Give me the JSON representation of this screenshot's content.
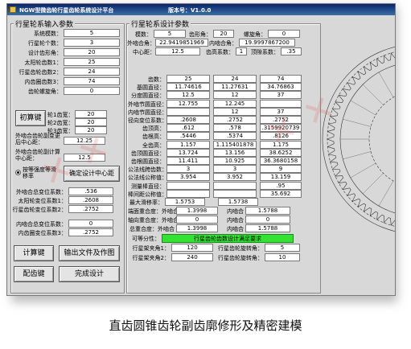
{
  "window": {
    "title": "NGW型微齿轮行星齿轮系统设计平台",
    "version": "版本号：V1.0.0"
  },
  "input_group": {
    "title": "行星轮系输入参数",
    "rows": [
      {
        "label": "系统模数：",
        "value": "5"
      },
      {
        "label": "行星轮个数：",
        "value": "3"
      },
      {
        "label": "设计齿形角：",
        "value": "20"
      },
      {
        "label": "太阳轮齿数1：",
        "value": "25"
      },
      {
        "label": "行星齿轮齿数2：",
        "value": "24"
      },
      {
        "label": "内齿圈齿数3：",
        "value": "74"
      },
      {
        "label": "齿轮螺旋角：",
        "value": "0"
      }
    ],
    "trial_button": "初算键",
    "trial_rows": [
      {
        "label": "轮1齿宽：",
        "value": "20"
      },
      {
        "label": "轮2齿宽：",
        "value": "20"
      },
      {
        "label": "轮3齿宽：",
        "value": "20"
      }
    ],
    "external_center_label": "外啮合齿轮副变更后中心距：",
    "external_center_value": "12.25",
    "external_calc_label": "外啮合齿轮副计算中心距：",
    "external_calc_value": "12.5",
    "radio_option": "按等强度等滑移率",
    "center_button": "确定设计中心距",
    "shift_rows_1": [
      {
        "label": "外啮合总变位系数：",
        "value": ".536"
      },
      {
        "label": "太阳轮变位系数1：",
        "value": ".2608"
      },
      {
        "label": "行星齿轮变位系数2：",
        "value": ".2752"
      }
    ],
    "shift_rows_2": [
      {
        "label": "内啮合总变位系数：",
        "value": "0"
      },
      {
        "label": "内齿圈变位系数3：",
        "value": ".2752"
      }
    ],
    "calc_button": "计算键",
    "export_button": "输出文件及作图",
    "match_button": "配齿键",
    "done_button": "完成设计"
  },
  "design_group": {
    "title": "行星轮系设计参数",
    "module_label": "模数：",
    "module_value": "5",
    "teeth_label": "齿形角：",
    "teeth_value": "20",
    "helix_label": "螺旋角：",
    "helix_value": "0",
    "ext_mesh_label": "外啮合角：",
    "ext_mesh_value": "22.9419851969",
    "int_mesh_label": "内啮合角：",
    "int_mesh_value": "19.9997867200",
    "center_label": "中心距：",
    "center_value": "12.5",
    "tooth_top_label": "齿高系数：",
    "tooth_top_value": "1",
    "clearance_label": "顶隙系数：",
    "clearance_value": ".35",
    "table_rows": [
      {
        "label": "齿数：",
        "v1": "25",
        "v2": "24",
        "v3": "74"
      },
      {
        "label": "基圆直径：",
        "v1": "11.74616",
        "v2": "11.27631",
        "v3": "34.76863"
      },
      {
        "label": "分度圆直径：",
        "v1": "12.5",
        "v2": "12",
        "v3": "37"
      },
      {
        "label": "外啮节圆直径：",
        "v1": "12.755",
        "v2": "12.245",
        "v3": ""
      },
      {
        "label": "内啮节圆直径：",
        "v1": "",
        "v2": "12",
        "v3": "37"
      },
      {
        "label": "径向变位系数：",
        "v1": ".2608",
        "v2": ".2752",
        "v3": ".2752"
      },
      {
        "label": "齿顶高：",
        "v1": ".612",
        "v2": ".578",
        "v3": ".3159920739"
      },
      {
        "label": "齿根高：",
        "v1": ".5446",
        "v2": ".5374",
        "v3": ".8126"
      },
      {
        "label": "全齿高：",
        "v1": "1.157",
        "v2": "1.115401878",
        "v3": "1.175"
      },
      {
        "label": "齿顶圆直径：",
        "v1": "13.724",
        "v2": "13.156",
        "v3": "38.6252"
      },
      {
        "label": "齿根圆直径：",
        "v1": "11.411",
        "v2": "10.925",
        "v3": "36.3680158"
      },
      {
        "label": "公法线跨齿数：",
        "v1": "3",
        "v2": "3",
        "v3": "9"
      },
      {
        "label": "公法线公称值：",
        "v1": "3.954",
        "v2": "3.952",
        "v3": "13.159"
      },
      {
        "label": "测量棒直径：",
        "v1": "",
        "v2": "",
        "v3": ".95"
      },
      {
        "label": "棒间距公称值：",
        "v1": "",
        "v2": "",
        "v3": "35.692"
      }
    ],
    "max_slide_label": "最大滑移率：",
    "max_slide_v1": "1.5753",
    "max_slide_v2": "1.5738",
    "contact_label": "端面重合度：外啮合",
    "contact_v1": "1.3998",
    "contact_inner_label": "内啮合",
    "contact_v2": "1.5788",
    "axial_label": "轴向重合度：外啮合",
    "axial_v1": "0",
    "axial_inner_label": "内啮合",
    "axial_v2": "0",
    "total_label": "总重合度：外啮合",
    "total_v1": "1.3998",
    "total_inner_label": "内啮合",
    "total_v2": "1.5788",
    "check_label": "可等分性：",
    "check_text": "行星齿轮齿数设计满足要求",
    "frame_angle1_label": "行星架夹角1：",
    "frame_angle1_value": "120",
    "frame_rot1_label": "行星齿轮旋转角：",
    "frame_rot1_value": "5",
    "frame_angle2_label": "行星架夹角2：",
    "frame_angle2_value": "240",
    "frame_rot2_label": "行星齿轮旋转角：",
    "frame_rot2_value": "10"
  },
  "caption": "直齿圆锥齿轮副齿廓修形及精密建模",
  "colors": {
    "title_bar": "#0a246a",
    "window_bg": "#d8d8d8",
    "green_status": "#33e233",
    "gear_line": "#333333"
  }
}
